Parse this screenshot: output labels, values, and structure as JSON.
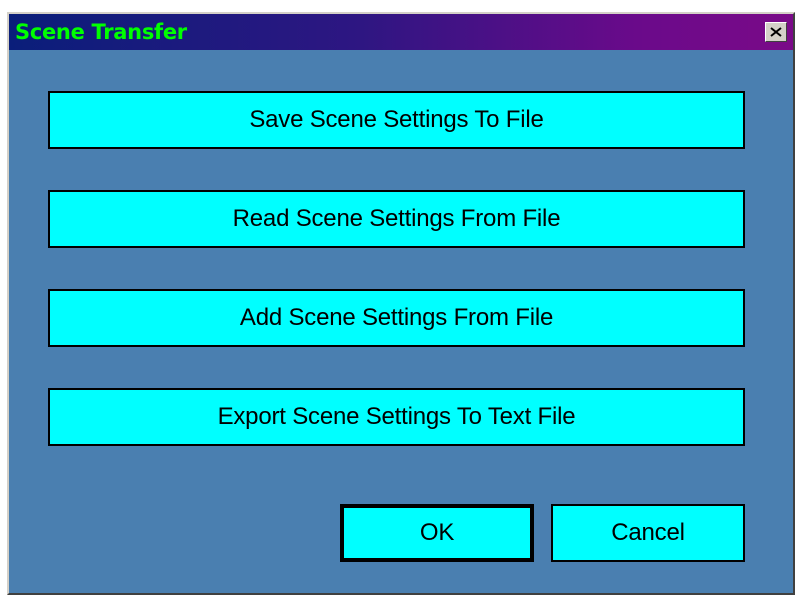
{
  "window": {
    "title": "Scene Transfer",
    "close_icon": "close-icon"
  },
  "actions": {
    "save": "Save Scene Settings To File",
    "read": "Read Scene Settings From File",
    "add": "Add Scene Settings From File",
    "export": "Export Scene Settings To Text File"
  },
  "footer": {
    "ok": "OK",
    "cancel": "Cancel"
  },
  "colors": {
    "background": "#4a7fb0",
    "button": "#00ffff",
    "title_text": "#00ff00"
  }
}
